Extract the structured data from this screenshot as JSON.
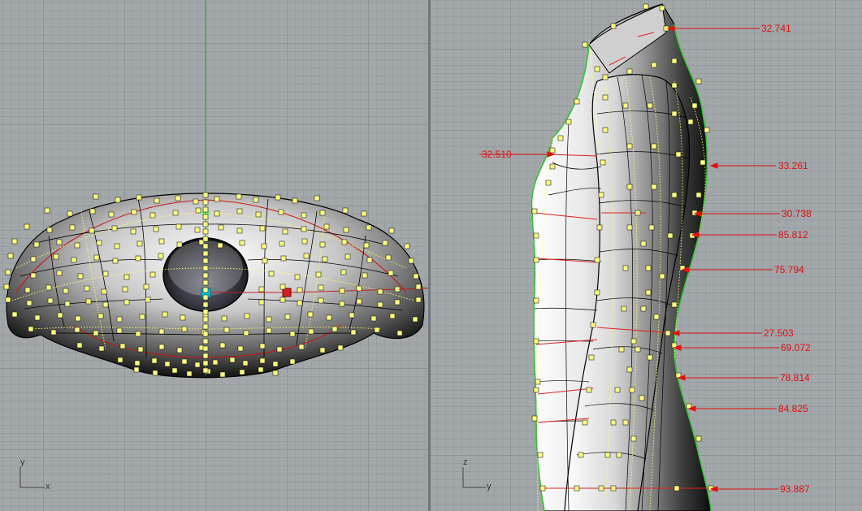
{
  "viewports": {
    "left": {
      "axis_x": "x",
      "axis_y": "y"
    },
    "right": {
      "axis_horizontal": "y",
      "axis_vertical": "z"
    }
  },
  "dimensions": [
    {
      "id": "d1",
      "value": "32.741"
    },
    {
      "id": "d2",
      "value": "32.510"
    },
    {
      "id": "d3",
      "value": "33.261"
    },
    {
      "id": "d4",
      "value": "30.738"
    },
    {
      "id": "d5",
      "value": "85.812"
    },
    {
      "id": "d6",
      "value": "75.794"
    },
    {
      "id": "d7",
      "value": "27.503"
    },
    {
      "id": "d8",
      "value": "69.072"
    },
    {
      "id": "d9",
      "value": "78.814"
    },
    {
      "id": "d10",
      "value": "84.825"
    },
    {
      "id": "d11",
      "value": "93.887"
    }
  ],
  "colors": {
    "background": "#a2a7aa",
    "grid": "#8e9498",
    "control_point": "#ffff80",
    "dimension": "#e01010",
    "axis_green": "#33aa33"
  }
}
